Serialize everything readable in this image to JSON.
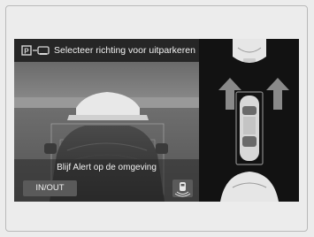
{
  "header": {
    "title": "Selecteer richting voor uitparkeren",
    "icon": "parking-exit-icon"
  },
  "camera": {
    "alert_text": "Blijf Alert op de omgeving"
  },
  "buttons": {
    "inout_label": "IN/OUT",
    "sensor_icon": "parking-sensor-icon"
  },
  "overview": {
    "icons": [
      "arrow-up-left-icon",
      "arrow-up-right-icon",
      "own-car-icon",
      "car-front-icon",
      "car-rear-icon"
    ]
  },
  "colors": {
    "screen_bg": "#0f0f0f",
    "panel_bg": "#2a2a2a",
    "button_bg": "#5a5a5a",
    "text": "#f2f2f2"
  }
}
